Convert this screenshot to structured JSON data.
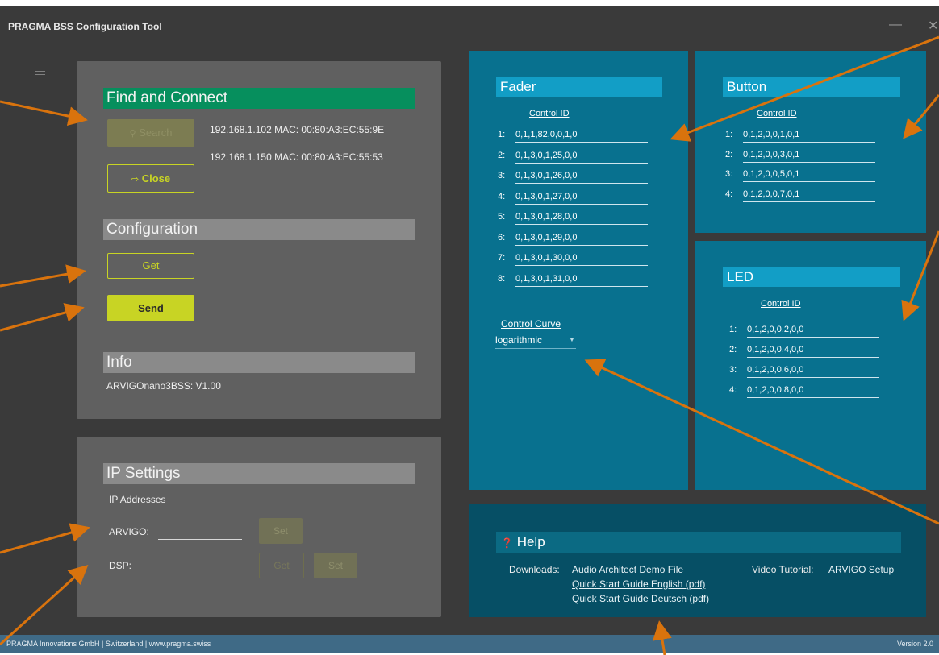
{
  "app": {
    "title": "PRAGMA BSS Configuration Tool",
    "footer_left": "PRAGMA Innovations GmbH | Switzerland | www.pragma.swiss",
    "footer_right": "Version 2.0"
  },
  "connect": {
    "heading": "Find and Connect",
    "search_label": "Search",
    "close_label": "Close",
    "devices": [
      "192.168.1.102  MAC: 00:80:A3:EC:55:9E",
      "192.168.1.150  MAC: 00:80:A3:EC:55:53"
    ]
  },
  "configuration": {
    "heading": "Configuration",
    "get_label": "Get",
    "send_label": "Send"
  },
  "info": {
    "heading": "Info",
    "device_version": "ARVIGOnano3BSS: V1.00"
  },
  "ip": {
    "heading": "IP Settings",
    "subheading": "IP Addresses",
    "arvigo_label": "ARVIGO:",
    "dsp_label": "DSP:",
    "set_label": "Set",
    "get_label": "Get"
  },
  "fader": {
    "heading": "Fader",
    "column": "Control ID",
    "rows": [
      {
        "n": "1:",
        "v": "0,1,1,82,0,0,1,0"
      },
      {
        "n": "2:",
        "v": "0,1,3,0,1,25,0,0"
      },
      {
        "n": "3:",
        "v": "0,1,3,0,1,26,0,0"
      },
      {
        "n": "4:",
        "v": "0,1,3,0,1,27,0,0"
      },
      {
        "n": "5:",
        "v": "0,1,3,0,1,28,0,0"
      },
      {
        "n": "6:",
        "v": "0,1,3,0,1,29,0,0"
      },
      {
        "n": "7:",
        "v": "0,1,3,0,1,30,0,0"
      },
      {
        "n": "8:",
        "v": "0,1,3,0,1,31,0,0"
      }
    ],
    "curve_label": "Control Curve",
    "curve_value": "logarithmic"
  },
  "button": {
    "heading": "Button",
    "column": "Control ID",
    "rows": [
      {
        "n": "1:",
        "v": "0,1,2,0,0,1,0,1"
      },
      {
        "n": "2:",
        "v": "0,1,2,0,0,3,0,1"
      },
      {
        "n": "3:",
        "v": "0,1,2,0,0,5,0,1"
      },
      {
        "n": "4:",
        "v": "0,1,2,0,0,7,0,1"
      }
    ]
  },
  "led": {
    "heading": "LED",
    "column": "Control ID",
    "rows": [
      {
        "n": "1:",
        "v": "0,1,2,0,0,2,0,0"
      },
      {
        "n": "2:",
        "v": "0,1,2,0,0,4,0,0"
      },
      {
        "n": "3:",
        "v": "0,1,2,0,0,6,0,0"
      },
      {
        "n": "4:",
        "v": "0,1,2,0,0,8,0,0"
      }
    ]
  },
  "help": {
    "heading": "Help",
    "downloads_label": "Downloads:",
    "links": [
      "Audio Architect Demo File",
      "Quick Start Guide English (pdf)",
      "Quick Start Guide Deutsch (pdf)"
    ],
    "video_label": "Video Tutorial:",
    "video_link": "ARVIGO Setup"
  },
  "colors": {
    "accent_yellow": "#c8d424",
    "connect_green": "#068f5d",
    "panel_blue": "#08718f",
    "header_blue": "#129ec6",
    "annotation_orange": "#d9730d"
  }
}
